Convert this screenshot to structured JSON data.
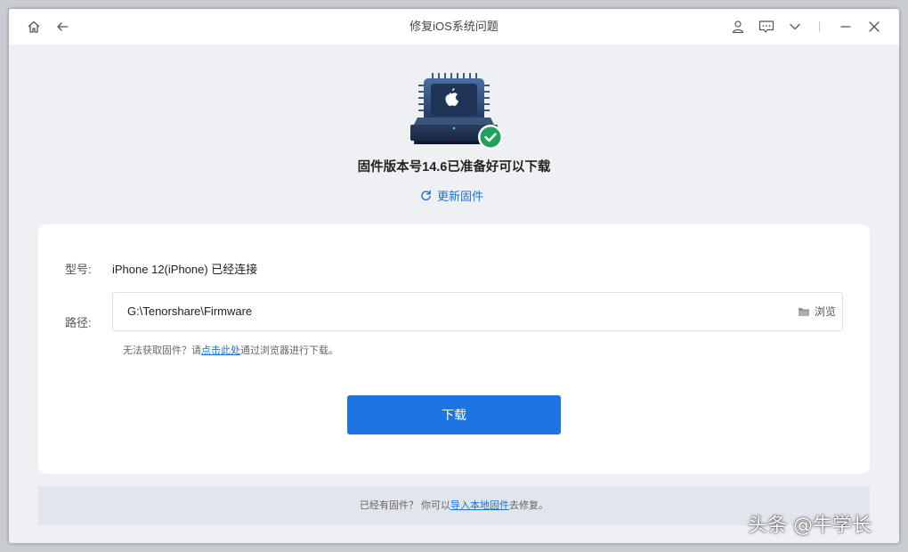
{
  "window": {
    "title": "修复iOS系统问题"
  },
  "icons": {
    "home": "home-icon",
    "back": "back-arrow-icon",
    "user": "user-icon",
    "feedback": "feedback-icon",
    "dropdown": "chevron-down-icon",
    "minimize": "minimize-icon",
    "close": "close-icon",
    "refresh": "refresh-icon",
    "folder": "folder-icon",
    "check": "check-circle-icon",
    "device": "firmware-chip-icon"
  },
  "colors": {
    "accent": "#1e74e0",
    "link": "#1e6fd9",
    "success": "#1fa35c"
  },
  "main": {
    "headline": "固件版本号14.6已准备好可以下载",
    "update_firmware": "更新固件"
  },
  "form": {
    "model_label": "型号:",
    "model_value": "iPhone 12(iPhone) 已经连接",
    "path_label": "路径:",
    "path_value": "G:\\Tenorshare\\Firmware",
    "browse_label": "浏览",
    "hint_prefix": "无法获取固件？请",
    "hint_link": "点击此处",
    "hint_suffix": "通过浏览器进行下载。",
    "download_button": "下载"
  },
  "footer": {
    "prefix": "已经有固件？ 你可以",
    "link": "导入本地固件",
    "suffix": "去修复。"
  },
  "watermark": "头条 @牛学长"
}
